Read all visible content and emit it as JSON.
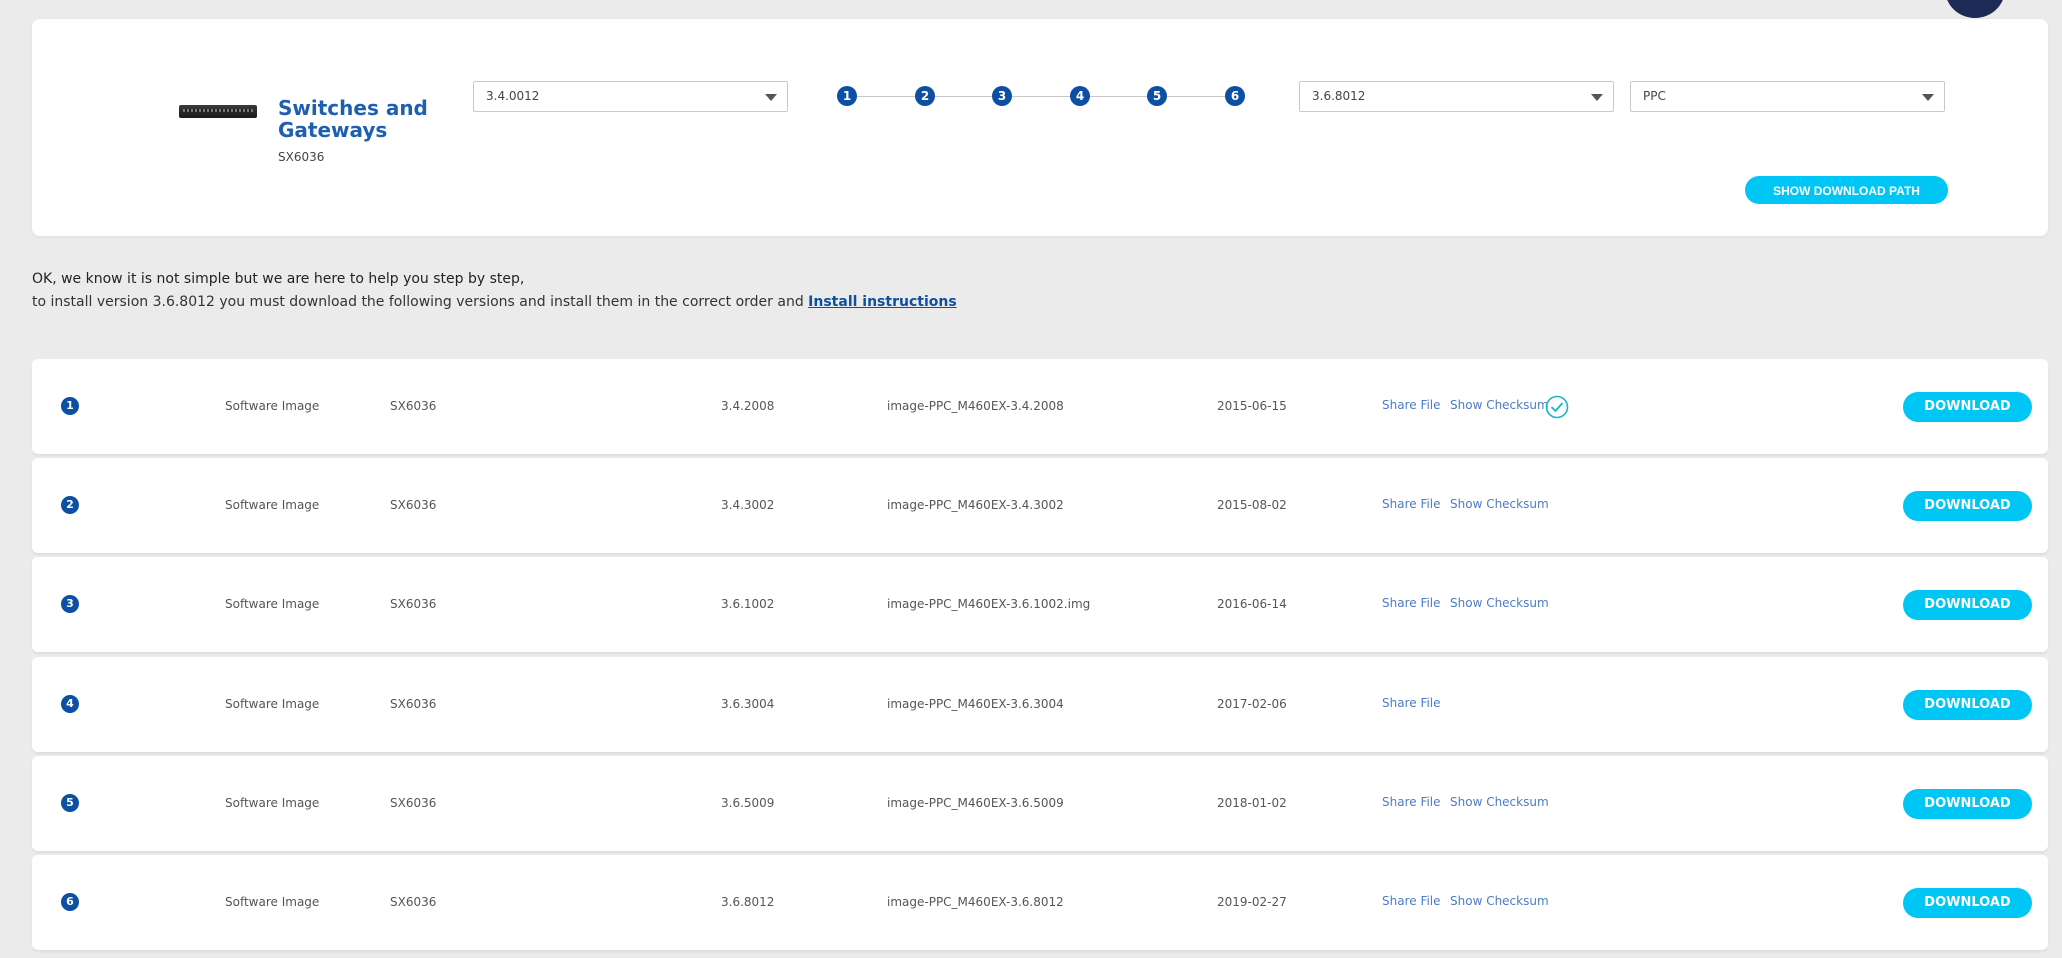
{
  "product": {
    "title": "Switches and Gateways",
    "model": "SX6036"
  },
  "selects": {
    "from_version": "3.4.0012",
    "to_version": "3.6.8012",
    "platform": "PPC"
  },
  "stepper": {
    "steps": [
      "1",
      "2",
      "3",
      "4",
      "5",
      "6"
    ]
  },
  "buttons": {
    "show_download_path": "SHOW DOWNLOAD PATH",
    "download": "DOWNLOAD"
  },
  "intro": {
    "line1": "OK, we know it is not simple but we are here to help you step by step,",
    "line2_prefix": "to install version 3.6.8012 you must download the following versions and install them in the correct order and ",
    "line2_link": "Install instructions"
  },
  "rows": [
    {
      "num": "1",
      "type": "Software Image",
      "model": "SX6036",
      "version": "3.4.2008",
      "file": "image-PPC_M460EX-3.4.2008",
      "date": "2015-06-15",
      "share": "Share File",
      "checksum": "Show Checksum",
      "verified": true
    },
    {
      "num": "2",
      "type": "Software Image",
      "model": "SX6036",
      "version": "3.4.3002",
      "file": "image-PPC_M460EX-3.4.3002",
      "date": "2015-08-02",
      "share": "Share File",
      "checksum": "Show Checksum",
      "verified": false
    },
    {
      "num": "3",
      "type": "Software Image",
      "model": "SX6036",
      "version": "3.6.1002",
      "file": "image-PPC_M460EX-3.6.1002.img",
      "date": "2016-06-14",
      "share": "Share File",
      "checksum": "Show Checksum",
      "verified": false
    },
    {
      "num": "4",
      "type": "Software Image",
      "model": "SX6036",
      "version": "3.6.3004",
      "file": "image-PPC_M460EX-3.6.3004",
      "date": "2017-02-06",
      "share": "Share File",
      "checksum": "",
      "verified": false
    },
    {
      "num": "5",
      "type": "Software Image",
      "model": "SX6036",
      "version": "3.6.5009",
      "file": "image-PPC_M460EX-3.6.5009",
      "date": "2018-01-02",
      "share": "Share File",
      "checksum": "Show Checksum",
      "verified": false
    },
    {
      "num": "6",
      "type": "Software Image",
      "model": "SX6036",
      "version": "3.6.8012",
      "file": "image-PPC_M460EX-3.6.8012",
      "date": "2019-02-27",
      "share": "Share File",
      "checksum": "Show Checksum",
      "verified": false
    }
  ],
  "colors": {
    "accent": "#00c6f5",
    "brand_blue": "#0d4fa3",
    "link": "#4d7cc6",
    "check": "#17b6c9"
  },
  "icons": {
    "verified": "check-circle-icon",
    "dropdown": "chevron-down-icon",
    "product": "switch-device-image"
  }
}
